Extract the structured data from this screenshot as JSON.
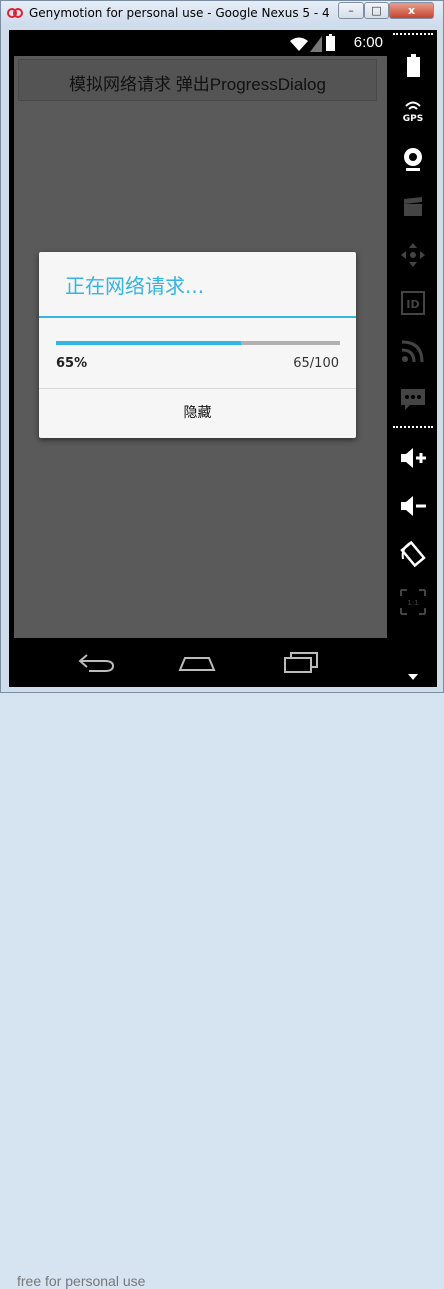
{
  "window": {
    "title": "Genymotion for personal use - Google Nexus 5 - 4...",
    "min_label": "–",
    "max_label": "□",
    "close_label": "x"
  },
  "status_bar": {
    "time": "6:00"
  },
  "app": {
    "action_bar_title": "模拟网络请求 弹出ProgressDialog"
  },
  "dialog": {
    "title": "正在网络请求...",
    "progress": 0.65,
    "percent_label": "65%",
    "number_label": "65/100",
    "button_label": "隐藏"
  },
  "watermark": "free for personal use",
  "side_toolbar": {
    "items": [
      "battery-icon",
      "gps-icon",
      "camera-icon",
      "video-icon",
      "dpad-icon",
      "id-icon",
      "rss-icon",
      "chat-icon",
      "volume-up-icon",
      "volume-down-icon",
      "rotate-icon",
      "scale-icon"
    ],
    "gps_label": "GPS",
    "id_label": "ID",
    "scale_label": "1:1"
  },
  "colors": {
    "accent": "#33b5e5",
    "dim": "#5a5a5a"
  }
}
